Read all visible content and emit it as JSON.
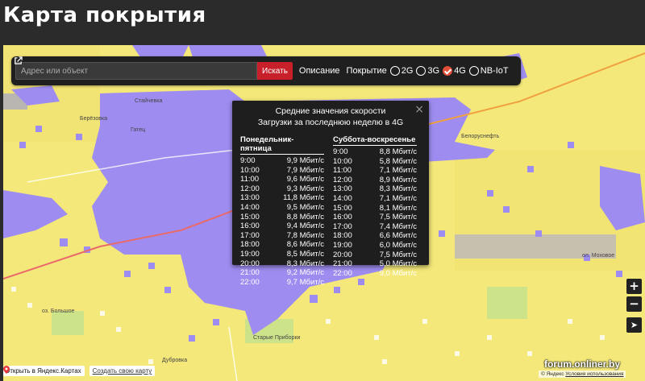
{
  "page": {
    "title": "Карта покрытия"
  },
  "toolbar": {
    "search_placeholder": "Адрес или объект",
    "search_button": "Искать",
    "description_link": "Описание",
    "coverage_label": "Покрытие",
    "options": [
      {
        "label": "2G",
        "checked": false
      },
      {
        "label": "3G",
        "checked": false
      },
      {
        "label": "4G",
        "checked": true
      },
      {
        "label": "NB-IoT",
        "checked": false
      }
    ]
  },
  "popup": {
    "close": "×",
    "title_line1": "Средние значения скорости",
    "title_line2": "Загрузки за последнюю неделю в 4G",
    "weekday": {
      "header": "Понедельник-пятница",
      "rows": [
        {
          "time": "9:00",
          "speed": "9,9 Мбит/с"
        },
        {
          "time": "10:00",
          "speed": "7,9 Мбит/с"
        },
        {
          "time": "11:00",
          "speed": "9,6 Мбит/с"
        },
        {
          "time": "12:00",
          "speed": "9,3 Мбит/с"
        },
        {
          "time": "13:00",
          "speed": "11,8 Мбит/с"
        },
        {
          "time": "14:00",
          "speed": "9,5 Мбит/с"
        },
        {
          "time": "15:00",
          "speed": "8,8 Мбит/с"
        },
        {
          "time": "16:00",
          "speed": "9,4 Мбит/с"
        },
        {
          "time": "17:00",
          "speed": "7,8 Мбит/с"
        },
        {
          "time": "18:00",
          "speed": "8,6 Мбит/с"
        },
        {
          "time": "19:00",
          "speed": "8,5 Мбит/с"
        },
        {
          "time": "20:00",
          "speed": "8,3 Мбит/с"
        },
        {
          "time": "21:00",
          "speed": "9,2 Мбит/с"
        },
        {
          "time": "22:00",
          "speed": "9,7 Мбит/с"
        }
      ]
    },
    "weekend": {
      "header": "Суббота-воскресенье",
      "rows": [
        {
          "time": "9:00",
          "speed": "8,8 Мбит/с"
        },
        {
          "time": "10:00",
          "speed": "5,8 Мбит/с"
        },
        {
          "time": "11:00",
          "speed": "7,1 Мбит/с"
        },
        {
          "time": "12:00",
          "speed": "8,9 Мбит/с"
        },
        {
          "time": "13:00",
          "speed": "8,3 Мбит/с"
        },
        {
          "time": "14:00",
          "speed": "7,1 Мбит/с"
        },
        {
          "time": "15:00",
          "speed": "8,1 Мбит/с"
        },
        {
          "time": "16:00",
          "speed": "7,5 Мбит/с"
        },
        {
          "time": "17:00",
          "speed": "7,4 Мбит/с"
        },
        {
          "time": "18:00",
          "speed": "6,6 Мбит/с"
        },
        {
          "time": "19:00",
          "speed": "6,0 Мбит/с"
        },
        {
          "time": "20:00",
          "speed": "7,5 Мбит/с"
        },
        {
          "time": "21:00",
          "speed": "5,0 Мбит/с"
        },
        {
          "time": "22:00",
          "speed": "9,0 Мбит/с"
        }
      ]
    }
  },
  "map": {
    "labels": {
      "staichevka": "Стайчевка",
      "berezovka": "Берёзовка",
      "gatsa": "Гатец",
      "belorusneft": "Белоруснефть",
      "ol_bolshoe": "оз. Большое",
      "ol_mokhove": "ол. Моховое",
      "starye_priborki": "Старые Приборки",
      "dubrovka": "Дубровка"
    },
    "zoom_in": "+",
    "zoom_out": "−",
    "locate": "➤",
    "open_in_yandex": "Открыть в Яндекс.Картах",
    "create_map": "Создать свою карту",
    "watermark": "forum.onliner.by",
    "copyright_prefix": "© Яндекс",
    "copyright_link": "Условия использования",
    "colors": {
      "coverage_4g": "#9e8cf0",
      "background": "#f4e87a",
      "grey_area": "#b9b5b0"
    }
  }
}
